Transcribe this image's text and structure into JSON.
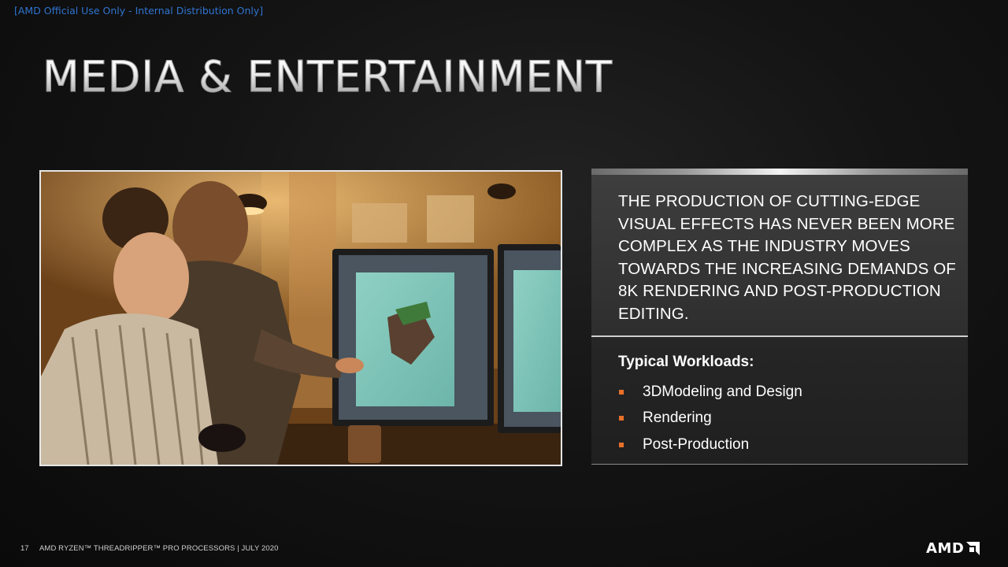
{
  "classification": "[AMD Official Use Only - Internal Distribution Only]",
  "title": "MEDIA & ENTERTAINMENT",
  "photo_alt": "",
  "panel": {
    "description": "THE PRODUCTION OF CUTTING-EDGE VISUAL EFFECTS HAS NEVER BEEN MORE COMPLEX AS THE INDUSTRY MOVES TOWARDS THE INCREASING DEMANDS OF 8K RENDERING AND POST-PRODUCTION EDITING.",
    "workloads_heading": "Typical Workloads:",
    "workloads": [
      "3DModeling and Design",
      "Rendering",
      "Post-Production"
    ],
    "bullet_color": "#e8702a"
  },
  "footer": {
    "page_number": "17",
    "text": "AMD RYZEN™ THREADRIPPER™ PRO PROCESSORS | JULY 2020"
  },
  "logo": {
    "text": "AMD",
    "icon": "amd-arrow-icon"
  }
}
